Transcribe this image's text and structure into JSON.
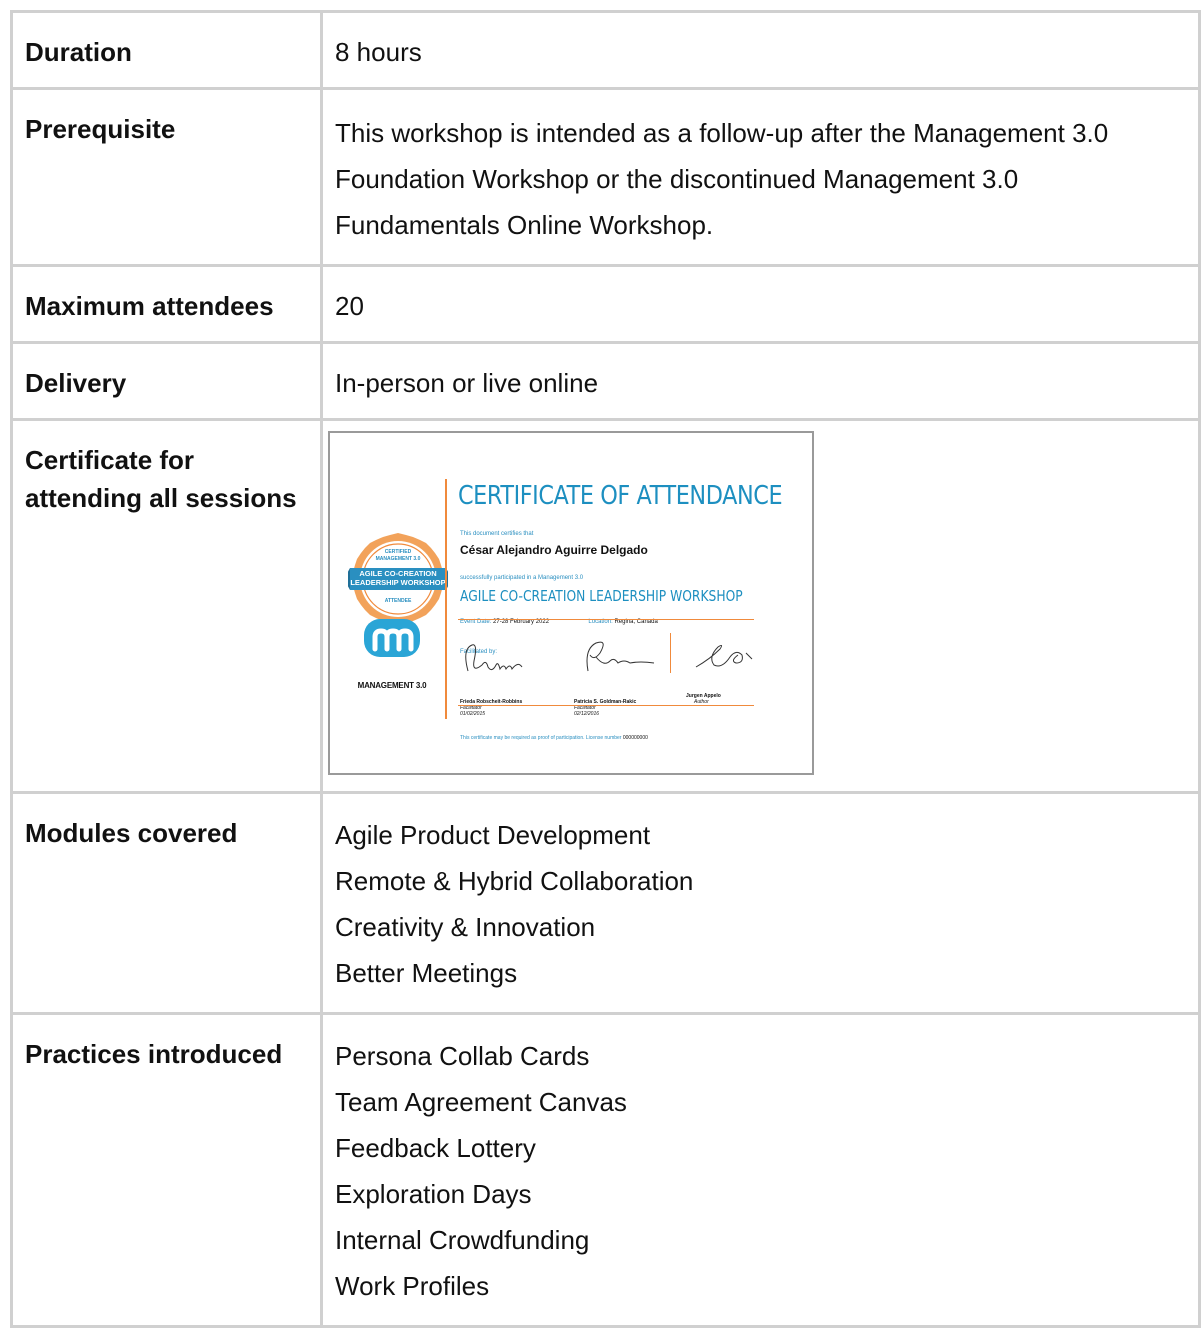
{
  "rows": [
    {
      "label": "Duration",
      "value": "8 hours"
    },
    {
      "label": "Prerequisite",
      "value": "This workshop is intended as a follow-up after the Management 3.0 Foundation Workshop or the discontinued Management 3.0 Fundamentals Online Workshop."
    },
    {
      "label": "Maximum attendees",
      "value": "20"
    },
    {
      "label": "Delivery",
      "value": "In-person or live online"
    },
    {
      "label": "Certificate for attending all sessions"
    },
    {
      "label": "Modules covered",
      "items": [
        "Agile Product Development",
        "Remote & Hybrid Collaboration",
        "Creativity & Innovation",
        "Better Meetings"
      ]
    },
    {
      "label": "Practices introduced",
      "items": [
        "Persona Collab Cards",
        "Team Agreement Canvas",
        "Feedback Lottery",
        "Exploration Days",
        "Internal Crowdfunding",
        "Work Profiles"
      ]
    }
  ],
  "certificate": {
    "title": "CERTIFICATE OF ATTENDANCE",
    "certifies_text": "This document certifies that",
    "recipient": "César Alejandro Aguirre Delgado",
    "participated_text": "successfully participated in a Management 3.0",
    "workshop_name": "AGILE CO-CREATION LEADERSHIP WORKSHOP",
    "event_date_label": "Event Date:",
    "event_date": "27-28 February 2022",
    "location_label": "Location:",
    "location": "Regina, Canada",
    "facilitated_by": "Facilitated by:",
    "signatories": [
      {
        "name": "Frieda Robscheit-Robbins",
        "role": "Facilitator",
        "date": "01/02/2015"
      },
      {
        "name": "Patricia S. Goldman-Rakic",
        "role": "Facilitator",
        "date": "02/12/2016"
      },
      {
        "name": "Jurgen Appelo",
        "role": "Author"
      }
    ],
    "footer": "This certificate may be required as proof of participation. License number",
    "license_number": "000000000",
    "badge_lines": [
      "CERTIFIED",
      "MANAGEMENT 3.0",
      "AGILE CO-CREATION",
      "LEADERSHIP WORKSHOP",
      "ATTENDEE"
    ],
    "logo_text": "MANAGEMENT 3.0",
    "colors": {
      "accent_blue": "#1d8fc0",
      "accent_orange": "#f08a3c",
      "badge_blue": "#2a8fc0"
    }
  }
}
